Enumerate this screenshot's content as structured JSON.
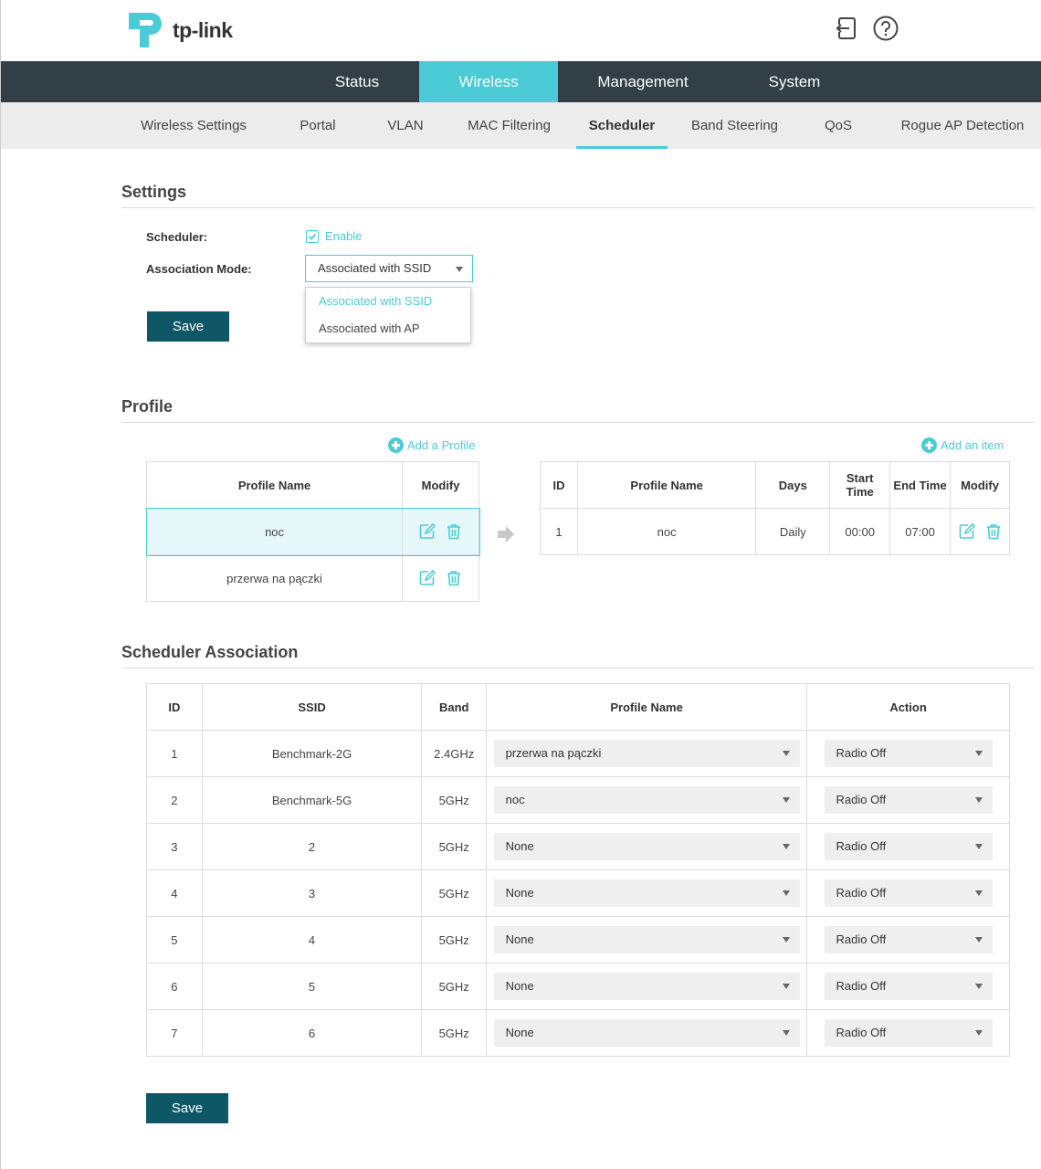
{
  "brand": {
    "logo_text": "tp-link"
  },
  "header_icons": [
    "logout-icon",
    "help-icon"
  ],
  "main_nav": [
    "Status",
    "Wireless",
    "Management",
    "System"
  ],
  "main_nav_active": "Wireless",
  "sub_nav": [
    "Wireless Settings",
    "Portal",
    "VLAN",
    "MAC Filtering",
    "Scheduler",
    "Band Steering",
    "QoS",
    "Rogue AP Detection"
  ],
  "sub_nav_active": "Scheduler",
  "settings": {
    "title": "Settings",
    "scheduler_label": "Scheduler:",
    "enable_label": "Enable",
    "enable_checked": true,
    "mode_label": "Association Mode:",
    "mode_value": "Associated with SSID",
    "mode_options": [
      "Associated with SSID",
      "Associated with AP"
    ],
    "save_label": "Save"
  },
  "profile": {
    "title": "Profile",
    "add_profile": "Add a Profile",
    "add_item": "Add an item",
    "left_headers": [
      "Profile Name",
      "Modify"
    ],
    "profiles": [
      "noc",
      "przerwa na pączki"
    ],
    "right_headers": [
      "ID",
      "Profile Name",
      "Days",
      "Start Time",
      "End Time",
      "Modify"
    ],
    "items": [
      {
        "id": "1",
        "profile": "noc",
        "days": "Daily",
        "start": "00:00",
        "end": "07:00"
      }
    ]
  },
  "association": {
    "title": "Scheduler Association",
    "headers": [
      "ID",
      "SSID",
      "Band",
      "Profile Name",
      "Action"
    ],
    "rows": [
      {
        "id": "1",
        "ssid": "Benchmark-2G",
        "band": "2.4GHz",
        "profile": "przerwa na pączki",
        "action": "Radio Off"
      },
      {
        "id": "2",
        "ssid": "Benchmark-5G",
        "band": "5GHz",
        "profile": "noc",
        "action": "Radio Off"
      },
      {
        "id": "3",
        "ssid": "2",
        "band": "5GHz",
        "profile": "None",
        "action": "Radio Off"
      },
      {
        "id": "4",
        "ssid": "3",
        "band": "5GHz",
        "profile": "None",
        "action": "Radio Off"
      },
      {
        "id": "5",
        "ssid": "4",
        "band": "5GHz",
        "profile": "None",
        "action": "Radio Off"
      },
      {
        "id": "6",
        "ssid": "5",
        "band": "5GHz",
        "profile": "None",
        "action": "Radio Off"
      },
      {
        "id": "7",
        "ssid": "6",
        "band": "5GHz",
        "profile": "None",
        "action": "Radio Off"
      }
    ],
    "save_label": "Save"
  },
  "colors": {
    "accent": "#4acbd6",
    "nav_bg": "#323f47",
    "button": "#0d5767",
    "subnav_bg": "#ececec"
  }
}
